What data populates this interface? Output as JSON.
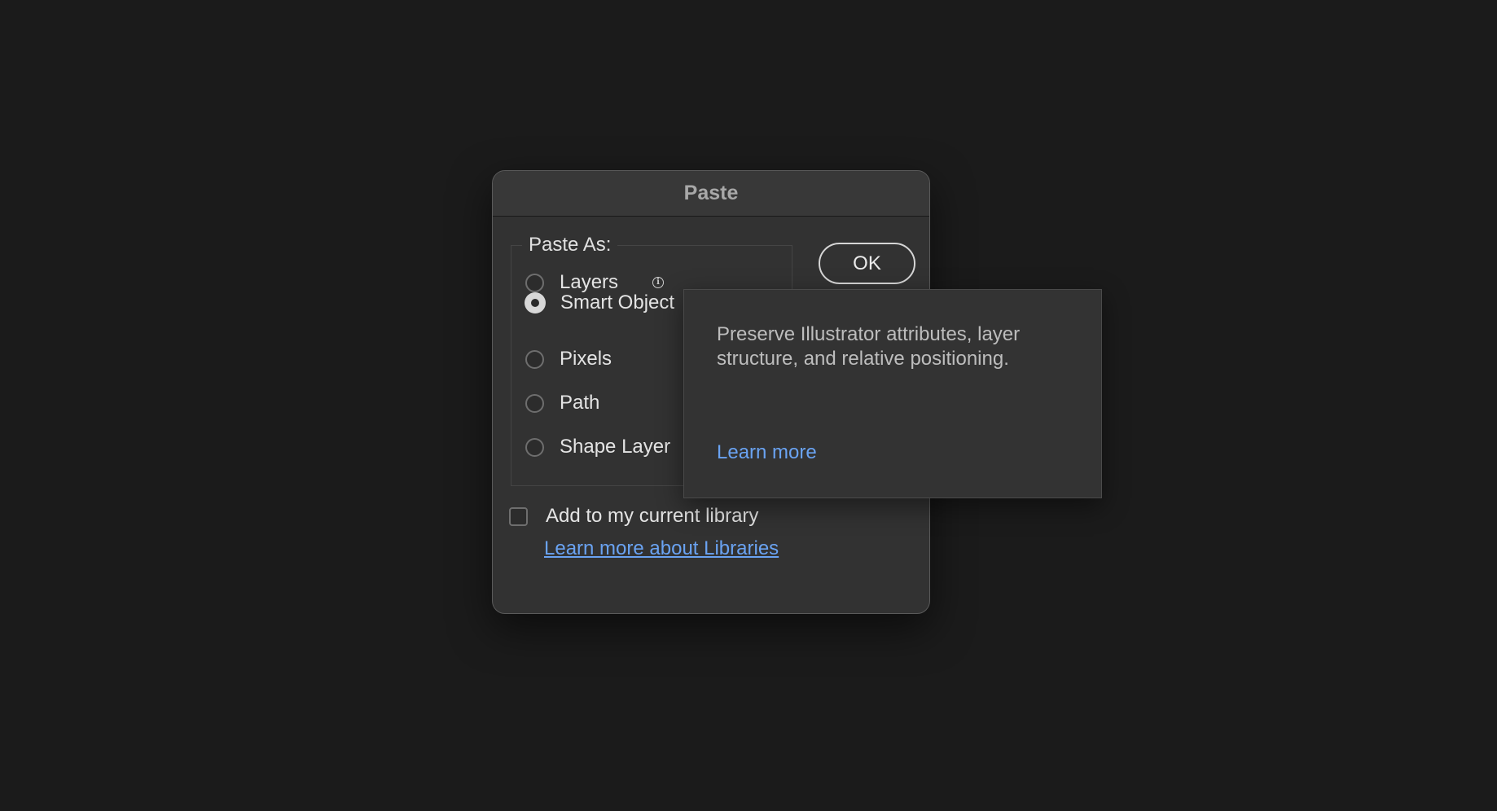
{
  "dialog": {
    "title": "Paste",
    "group_label": "Paste As:",
    "options": [
      {
        "label": "Layers",
        "checked": false
      },
      {
        "label": "Smart Object",
        "checked": true
      },
      {
        "label": "Pixels",
        "checked": false
      },
      {
        "label": "Path",
        "checked": false
      },
      {
        "label": "Shape Layer",
        "checked": false
      }
    ],
    "ok_label": "OK",
    "library_checkbox_label": "Add to my current library",
    "library_checkbox_checked": false,
    "library_link": "Learn more about Libraries"
  },
  "tooltip": {
    "text": "Preserve Illustrator attributes, layer structure, and relative positioning.",
    "link": "Learn more"
  },
  "colors": {
    "background": "#1b1b1b",
    "dialog": "#323232",
    "link": "#6aa3f2"
  },
  "icons": {
    "info": "info-icon"
  }
}
